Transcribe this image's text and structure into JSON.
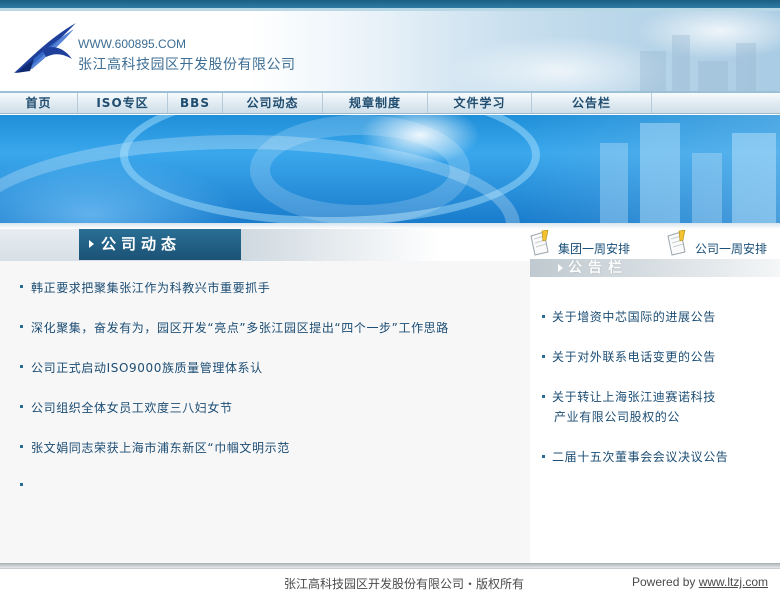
{
  "header": {
    "site_url": "WWW.600895.COM",
    "company_name": "张江高科技园区开发股份有限公司"
  },
  "nav": {
    "items": [
      {
        "label": "首页"
      },
      {
        "label": "ISO专区"
      },
      {
        "label": "BBS"
      },
      {
        "label": "公司动态"
      },
      {
        "label": "规章制度"
      },
      {
        "label": "文件学习"
      },
      {
        "label": "公告栏"
      }
    ]
  },
  "news": {
    "title": "公司动态",
    "items": [
      "韩正要求把聚集张江作为科教兴市重要抓手",
      "深化聚集，奋发有为，园区开发“亮点”多张江园区提出“四个一步”工作思路",
      "公司正式启动ISO9000族质量管理体系认",
      "公司组织全体女员工欢度三八妇女节",
      "张文娟同志荣获上海市浦东新区“巾帼文明示范",
      ""
    ]
  },
  "schedules": {
    "group": "集团一周安排",
    "company": "公司一周安排"
  },
  "notices": {
    "title": "公告栏",
    "items": [
      {
        "line1": "关于增资中芯国际的进展公告",
        "line2": ""
      },
      {
        "line1": "关于对外联系电话变更的公告",
        "line2": ""
      },
      {
        "line1": "关于转让上海张江迪赛诺科技",
        "line2": "产业有限公司股权的公"
      },
      {
        "line1": "二届十五次董事会会议决议公告",
        "line2": ""
      }
    ]
  },
  "footer": {
    "copyright": "张江高科技园区开发股份有限公司・版权所有",
    "powered_prefix": "Powered by ",
    "powered_link": "www.ltzj.com"
  },
  "colors": {
    "brand_dark": "#1b5276",
    "nav_text": "#204d70",
    "link_text": "#1c4d74"
  }
}
